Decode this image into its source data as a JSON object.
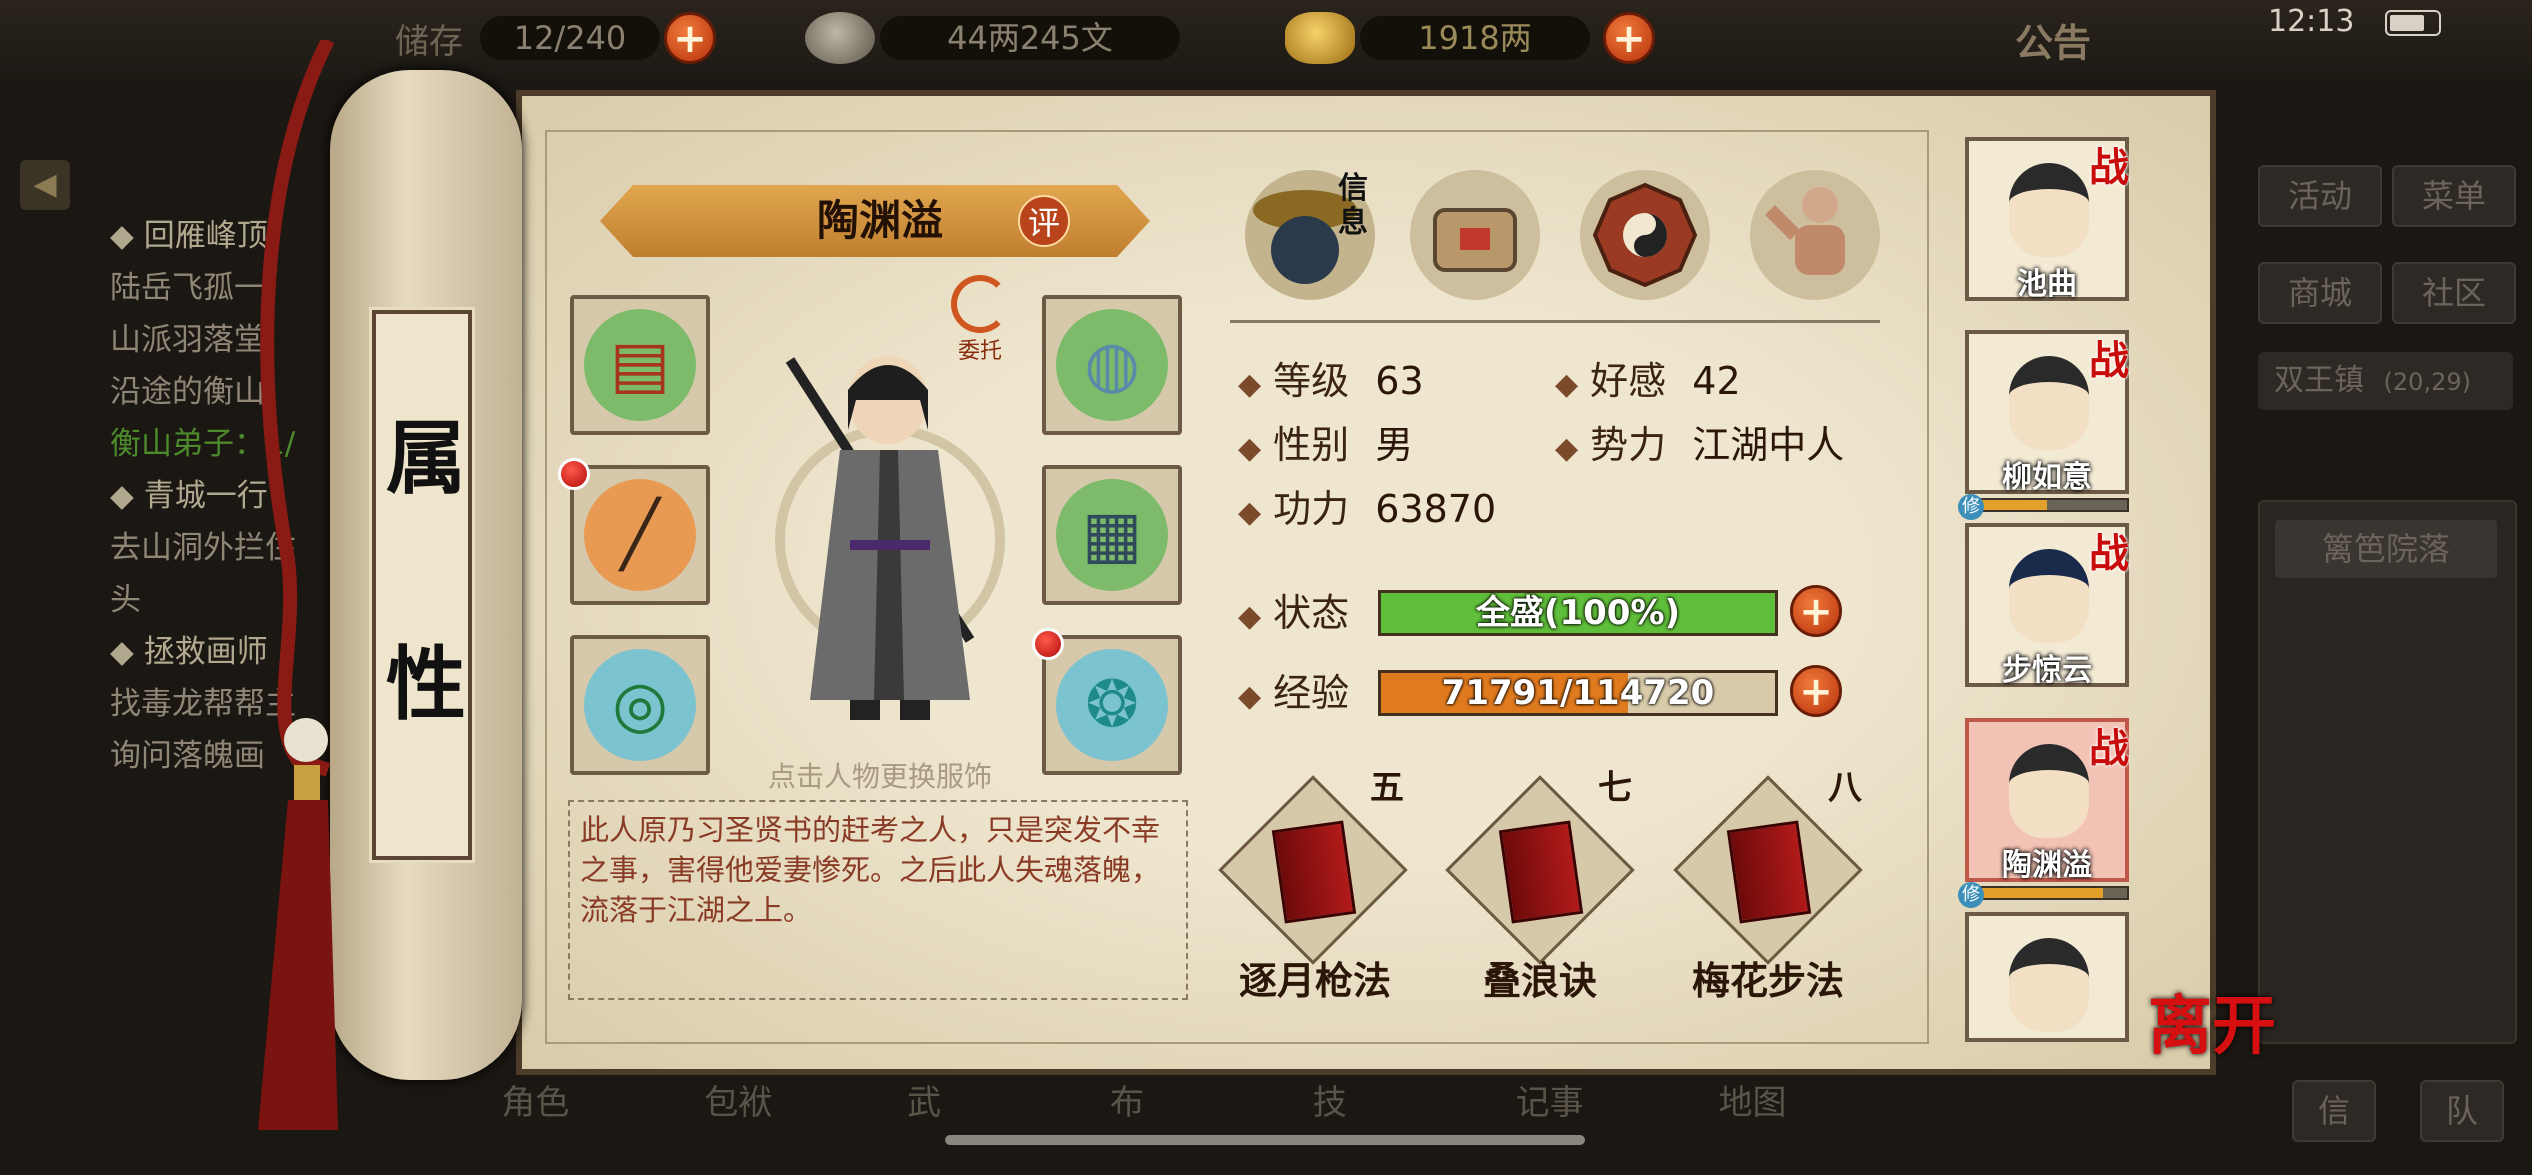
{
  "topbar": {
    "storage_label": "储存",
    "storage_value": "12/240",
    "silver_value": "44两245文",
    "gold_value": "1918两",
    "notice_label": "公告",
    "time": "12:13"
  },
  "left_panel": {
    "back_arrow": "◀",
    "quests": [
      {
        "title": "回雁峰顶",
        "lines": [
          "陆岳飞孤一",
          "山派羽落堂",
          "沿途的衡山"
        ],
        "count": "衡山弟子：1/"
      },
      {
        "title": "青城一行",
        "lines": [
          "去山洞外拦住",
          "头"
        ]
      },
      {
        "title": "拯救画师",
        "lines": [
          "找毒龙帮帮主",
          "询问落魄画"
        ]
      }
    ]
  },
  "right_menu": {
    "activity": "活动",
    "menu": "菜单",
    "shop": "商城",
    "community": "社区",
    "location": "双王镇",
    "coords": "(20,29)",
    "location_tab": "篱笆院落",
    "btn_a": "信",
    "btn_b": "队"
  },
  "scroll": {
    "chars": [
      "属",
      "性"
    ]
  },
  "character": {
    "name": "陶渊溢",
    "eval_label": "评",
    "delegate_label": "委托",
    "hint": "点击人物更换服饰",
    "description": "此人原乃习圣贤书的赶考之人，只是突发不幸之事，害得他爱妻惨死。之后此人失魂落魄，流落于江湖之上。"
  },
  "tabs": {
    "info_label": "信息"
  },
  "stats": {
    "level_label": "等级",
    "level": "63",
    "favor_label": "好感",
    "favor": "42",
    "gender_label": "性别",
    "gender": "男",
    "faction_label": "势力",
    "faction": "江湖中人",
    "power_label": "功力",
    "power": "63870",
    "status_label": "状态",
    "status_text": "全盛(100%)",
    "status_fraction": 1.0,
    "exp_label": "经验",
    "exp_text": "71791/114720",
    "exp_fraction": 0.626,
    "status_color": "#5fbe3a",
    "exp_color": "#e07a1e"
  },
  "skills": [
    {
      "level": "五",
      "name": "逐月枪法"
    },
    {
      "level": "七",
      "name": "叠浪诀"
    },
    {
      "level": "八",
      "name": "梅花步法"
    }
  ],
  "roster": [
    {
      "name": "池曲",
      "badge": "战",
      "has_bar": false
    },
    {
      "name": "柳如意",
      "badge": "战",
      "has_bar": true,
      "bar": 0.5,
      "tag": "修"
    },
    {
      "name": "步惊云",
      "badge": "战",
      "has_bar": false
    },
    {
      "name": "陶渊溢",
      "badge": "战",
      "has_bar": true,
      "bar": 0.85,
      "tag": "修",
      "active": true
    },
    {
      "name": "",
      "badge": "",
      "has_bar": false
    }
  ],
  "leave_label": "离开",
  "bottom_nav": [
    "角色",
    "包袱",
    "武",
    "布",
    "技",
    "记事",
    "地图"
  ]
}
